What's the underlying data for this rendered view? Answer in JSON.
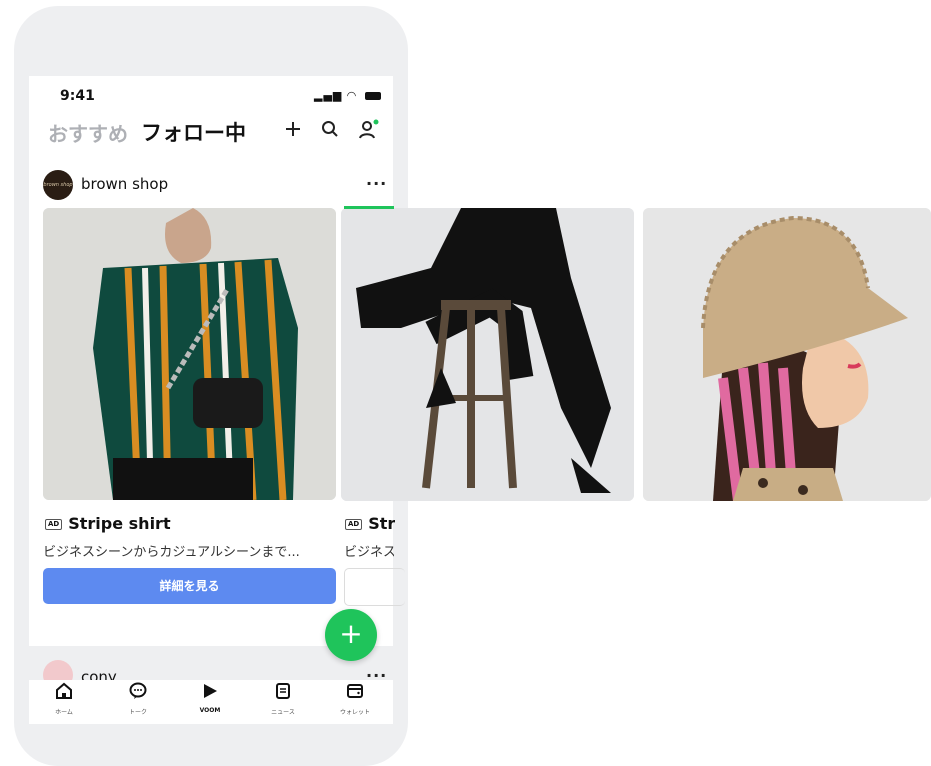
{
  "status": {
    "time": "9:41"
  },
  "header": {
    "tab_recommend": "おすすめ",
    "tab_following": "フォロー中"
  },
  "post1": {
    "shop_name": "brown shop",
    "avatar_text": "brown shop",
    "more": "···",
    "cards": [
      {
        "ad": "AD",
        "title": "Stripe shirt",
        "description": "ビジネスシーンからカジュアルシーンまで...",
        "cta": "詳細を見る"
      },
      {
        "ad": "AD",
        "title": "Stri",
        "description": "ビジネス"
      }
    ]
  },
  "post2": {
    "user_name": "cony",
    "more": "···"
  },
  "bottom_nav": [
    {
      "icon": "home-icon",
      "label": "ホーム"
    },
    {
      "icon": "chat-icon",
      "label": "トーク"
    },
    {
      "icon": "voom-icon",
      "label": "VOOM"
    },
    {
      "icon": "news-icon",
      "label": "ニュース"
    },
    {
      "icon": "wallet-icon",
      "label": "ウォレット"
    }
  ],
  "colors": {
    "accent": "#1fc45b",
    "cta": "#5d8af0"
  }
}
